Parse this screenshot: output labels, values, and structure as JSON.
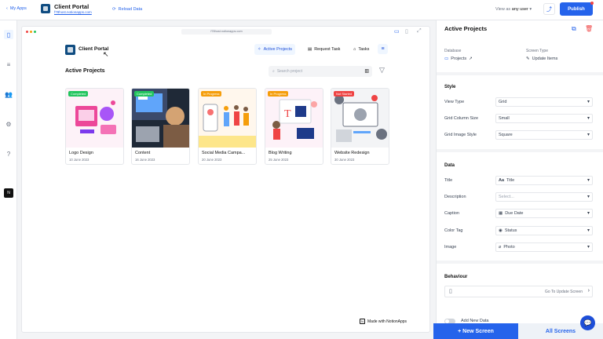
{
  "topbar": {
    "back_label": "My Apps",
    "app_title": "Client Portal",
    "app_url": "f78host.notionapps.com",
    "reload_label": "Reload Data",
    "view_as_prefix": "View as",
    "view_as_value": "any user",
    "publish_label": "Publish"
  },
  "browser": {
    "url": "f78host.notionapps.com"
  },
  "app": {
    "title": "Client Portal",
    "nav": {
      "active_projects": "Active Projects",
      "request_task": "Request Task",
      "tasks": "Tasks"
    },
    "section_title": "Active Projects",
    "search_placeholder": "Search project",
    "made_with": "Made with NotionApps"
  },
  "cards": [
    {
      "name": "Logo Design",
      "date": "10 June 2023",
      "status": "Completed",
      "status_color": "#22c55e"
    },
    {
      "name": "Content",
      "date": "16 June 2023",
      "status": "Completed",
      "status_color": "#22c55e"
    },
    {
      "name": "Social Media Campa...",
      "date": "20 June 2023",
      "status": "In Progress",
      "status_color": "#f59e0b"
    },
    {
      "name": "Blog Writing",
      "date": "25 June 2023",
      "status": "In Progress",
      "status_color": "#f59e0b"
    },
    {
      "name": "Website Redesign",
      "date": "30 June 2023",
      "status": "Not Started",
      "status_color": "#ef4444"
    }
  ],
  "panel": {
    "title": "Active Projects",
    "database_label": "Database",
    "database_value": "Projects",
    "screen_type_label": "Screen Type",
    "screen_type_value": "Update Items",
    "style_title": "Style",
    "view_type_label": "View Type",
    "view_type_value": "Grid",
    "grid_column_size_label": "Grid Column Size",
    "grid_column_size_value": "Small",
    "grid_image_style_label": "Grid Image Style",
    "grid_image_style_value": "Square",
    "data_title": "Data",
    "title_label": "Title",
    "title_value": "Title",
    "description_label": "Description",
    "description_placeholder": "Select...",
    "caption_label": "Caption",
    "caption_value": "Due Date",
    "color_tag_label": "Color Tag",
    "color_tag_value": "Status",
    "image_label": "Image",
    "image_value": "Photo",
    "behaviour_title": "Behaviour",
    "behaviour_nav": "Go To Update Screen",
    "add_new_label": "Add New Data"
  },
  "footer": {
    "new_screen": "+ New Screen",
    "all_screens": "All Screens"
  },
  "colors": {
    "primary": "#2563eb",
    "brand": "#0f4c81"
  }
}
